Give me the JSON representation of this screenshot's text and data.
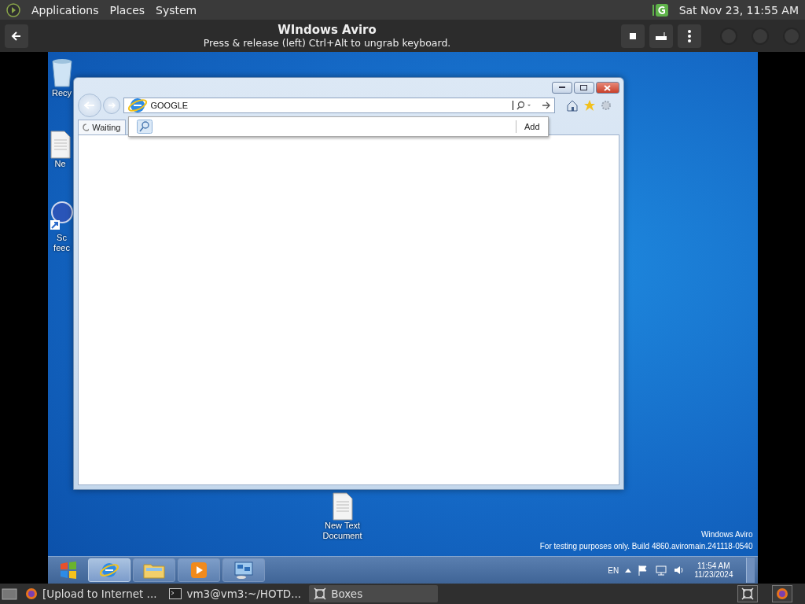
{
  "top_panel": {
    "menus": [
      "Applications",
      "Places",
      "System"
    ],
    "clock": "Sat Nov 23, 11:55 AM"
  },
  "header": {
    "title": "WIndows Aviro",
    "subtitle": "Press & release (left) Ctrl+Alt to ungrab keyboard."
  },
  "desktop": {
    "icons": [
      {
        "kind": "recycle",
        "lines": [
          "Recy"
        ]
      },
      {
        "kind": "file",
        "lines": [
          "Ne"
        ]
      },
      {
        "kind": "shortcut",
        "lines": [
          "Sc",
          "feec"
        ]
      },
      {
        "kind": "file",
        "lines": [
          "New Text",
          "Document"
        ]
      }
    ]
  },
  "browser": {
    "address": "GOOGLE",
    "tab": "Waiting",
    "suggest_button": "Add"
  },
  "watermark": {
    "title": "Windows Aviro",
    "build": "For testing purposes only. Build 4860.aviromain.241118-0540"
  },
  "taskbar": {
    "apps": [
      {
        "kind": "ie",
        "selected": true
      },
      {
        "kind": "folder",
        "selected": false
      },
      {
        "kind": "media",
        "selected": false
      },
      {
        "kind": "network",
        "selected": false
      }
    ],
    "language": "EN",
    "time": "11:54 AM",
    "date": "11/23/2024"
  },
  "bottom_panel": {
    "tasks": [
      {
        "kind": "firefox",
        "label": "[Upload to Internet ...",
        "selected": false
      },
      {
        "kind": "terminal",
        "label": "vm3@vm3:~/HOTD...",
        "selected": false
      },
      {
        "kind": "boxes",
        "label": "Boxes",
        "selected": true
      }
    ]
  }
}
